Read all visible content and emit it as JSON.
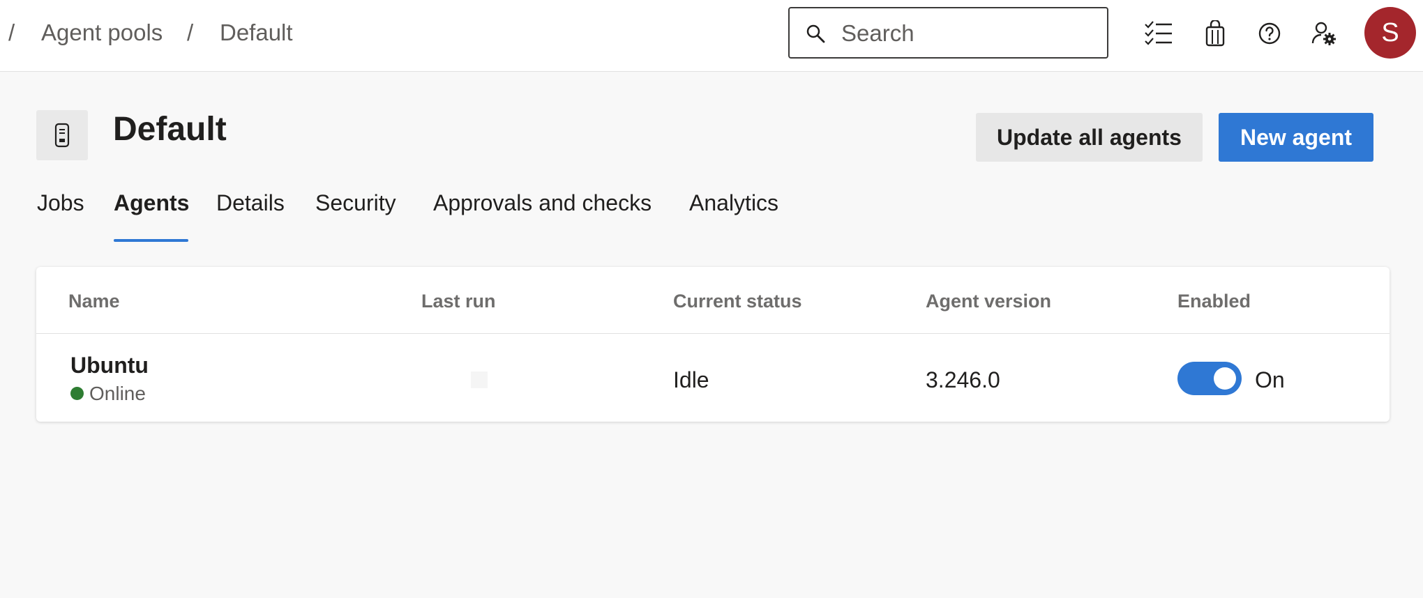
{
  "breadcrumb": {
    "separator": "/",
    "items": [
      "Agent pools",
      "Default"
    ]
  },
  "search": {
    "placeholder": "Search",
    "value": ""
  },
  "toolbar_icons": [
    "checklist-icon",
    "shopping-bag-icon",
    "help-icon",
    "user-settings-icon"
  ],
  "user": {
    "avatar_initial": "S",
    "avatar_color": "#a4262c"
  },
  "page": {
    "title": "Default",
    "icon": "agent-pool-icon"
  },
  "actions": {
    "update_all_label": "Update all agents",
    "new_agent_label": "New agent"
  },
  "tabs": [
    {
      "label": "Jobs",
      "active": false
    },
    {
      "label": "Agents",
      "active": true
    },
    {
      "label": "Details",
      "active": false
    },
    {
      "label": "Security",
      "active": false
    },
    {
      "label": "Approvals and checks",
      "active": false
    },
    {
      "label": "Analytics",
      "active": false
    }
  ],
  "table": {
    "columns": [
      "Name",
      "Last run",
      "Current status",
      "Agent version",
      "Enabled"
    ],
    "rows": [
      {
        "name": "Ubuntu",
        "connection": "Online",
        "last_run": "",
        "current_status": "Idle",
        "agent_version": "3.246.0",
        "enabled": true,
        "enabled_label": "On"
      }
    ]
  },
  "colors": {
    "accent": "#2f78d4",
    "online": "#2e7d32",
    "background": "#f8f8f8"
  }
}
